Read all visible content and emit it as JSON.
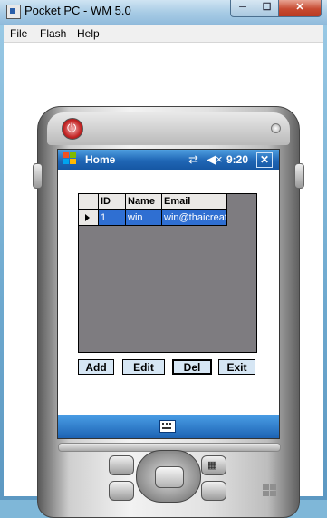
{
  "window": {
    "title": "Pocket PC - WM 5.0",
    "minimize_glyph": "─",
    "maximize_glyph": "☐",
    "close_glyph": "✕"
  },
  "menubar": {
    "items": [
      "File",
      "Flash",
      "Help"
    ]
  },
  "device": {
    "power_glyph": "⏻",
    "taskbar": {
      "title": "Home",
      "connectivity_glyph": "⇄",
      "volume_glyph": "◀×",
      "time": "9:20",
      "close_label": "✕"
    },
    "grid": {
      "columns": [
        "ID",
        "Name",
        "Email"
      ],
      "rows": [
        {
          "id": "1",
          "name": "win",
          "email": "win@thaicreate"
        }
      ]
    },
    "buttons": {
      "add": "Add",
      "edit": "Edit",
      "del": "Del",
      "exit": "Exit"
    },
    "softkey_icon": "keyboard-icon",
    "left_hw_glyph": "",
    "right_hw_glyph": "▦"
  },
  "colors": {
    "taskbar_blue": "#1f66b5",
    "grid_background": "#7e7c80",
    "selected_row": "#2f6fd2",
    "button_face": "#d6e6f4"
  }
}
